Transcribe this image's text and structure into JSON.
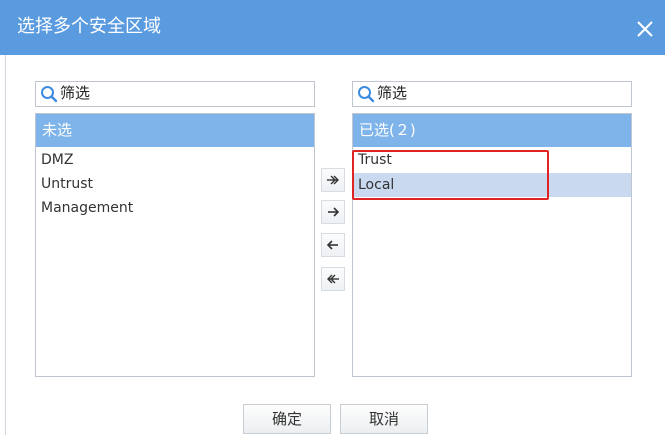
{
  "dialog": {
    "title": "选择多个安全区域"
  },
  "left": {
    "search_placeholder": "筛选",
    "header": "未选",
    "items": [
      "DMZ",
      "Untrust",
      "Management"
    ]
  },
  "right": {
    "search_placeholder": "筛选",
    "header": "已选(２)",
    "items": [
      "Trust",
      "Local"
    ],
    "selected_item": "Local"
  },
  "transfer": {
    "add_all": "»",
    "add": "→",
    "remove": "←",
    "remove_all": "«"
  },
  "buttons": {
    "ok": "确定",
    "cancel": "取消"
  },
  "colors": {
    "titlebar": "#5a9be0",
    "panel_header": "#7eb4ea",
    "selected_row": "#c9d9f0",
    "highlight": "#e02424"
  },
  "icons": [
    "close-icon",
    "search-icon",
    "double-arrow-right-icon",
    "arrow-right-icon",
    "arrow-left-icon",
    "double-arrow-left-icon"
  ]
}
